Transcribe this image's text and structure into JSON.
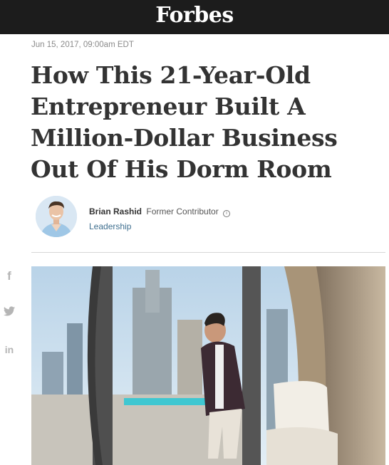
{
  "header": {
    "logo": "Forbes",
    "background_color": "#1c1c1c"
  },
  "article": {
    "date": "Jun 15, 2017, 09:00am EDT",
    "headline": "How This 21-Year-Old Entrepreneur Built A Million-Dollar Business Out Of His Dorm Room",
    "author": {
      "name": "Brian Rashid",
      "role": "Former Contributor",
      "channel": "Leadership"
    }
  },
  "share": {
    "facebook": "f",
    "linkedin": "in",
    "icons": [
      "facebook-icon",
      "twitter-icon",
      "linkedin-icon"
    ]
  },
  "colors": {
    "channel_link": "#3f6f8f",
    "share_icon": "#b5b5b5"
  }
}
